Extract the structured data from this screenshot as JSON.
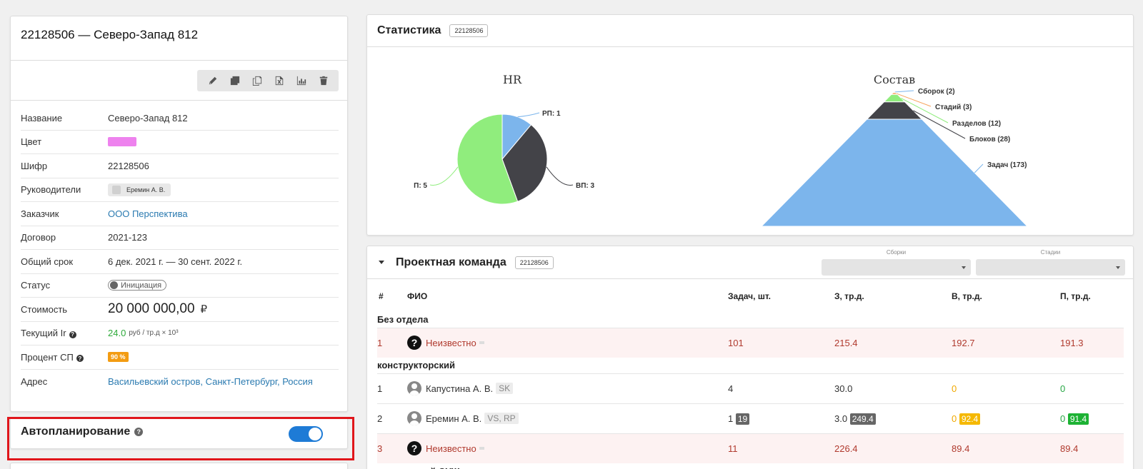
{
  "project": {
    "title": "22128506 — Северо-Запад 812",
    "toolbar_icons": [
      "pencil-icon",
      "copy-icon",
      "duplicate-icon",
      "excel-icon",
      "chart-icon",
      "trash-icon"
    ]
  },
  "props": {
    "name_label": "Название",
    "name_value": "Северо-Запад 812",
    "color_label": "Цвет",
    "color_value": "#ee82ee",
    "code_label": "Шифр",
    "code_value": "22128506",
    "managers_label": "Руководители",
    "managers_value": "Еремин А. В.",
    "customer_label": "Заказчик",
    "customer_value": "ООО Перспектива",
    "contract_label": "Договор",
    "contract_value": "2021-123",
    "term_label": "Общий срок",
    "term_value": "6 дек. 2021 г. — 30 сент. 2022 г.",
    "status_label": "Статус",
    "status_value": "Инициация",
    "cost_label": "Стоимость",
    "cost_value": "20 000 000,00",
    "cost_currency": "₽",
    "ir_label": "Текущий Ir",
    "ir_value": "24.0",
    "ir_unit": "руб / тр.д × 10³",
    "sp_label": "Процент СП",
    "sp_value": "90 %",
    "address_label": "Адрес",
    "address_value": "Васильевский остров, Санкт-Петербург, Россия"
  },
  "auto": {
    "title": "Автопланирование",
    "enabled": true
  },
  "stats": {
    "title": "Статистика",
    "tag": "22128506",
    "hr_title": "HR",
    "composition_title": "Состав"
  },
  "chart_data": [
    {
      "type": "pie",
      "title": "HR",
      "categories": [
        "РП",
        "ВП",
        "П"
      ],
      "values": [
        1,
        3,
        5
      ],
      "labels": [
        "РП: 1",
        "ВП: 3",
        "П: 5"
      ],
      "colors": [
        "#7cb5ec",
        "#434348",
        "#90ed7d"
      ]
    },
    {
      "type": "pyramid",
      "title": "Состав",
      "categories": [
        "Сборок",
        "Стадий",
        "Разделов",
        "Блоков",
        "Задач"
      ],
      "values": [
        2,
        3,
        12,
        28,
        173
      ],
      "labels": [
        "Сборок (2)",
        "Стадий (3)",
        "Разделов (12)",
        "Блоков (28)",
        "Задач (173)"
      ],
      "colors": [
        "#7cb5ec",
        "#f7a35c",
        "#90ed7d",
        "#434348",
        "#7cb5ec"
      ]
    }
  ],
  "team": {
    "title": "Проектная команда",
    "tag": "22128506",
    "filter1_label": "Сборки",
    "filter2_label": "Стадии",
    "headers": {
      "idx": "#",
      "name": "ФИО",
      "tasks": "Задач, шт.",
      "z": "З, тр.д.",
      "v": "В, тр.д.",
      "p": "П, тр.д."
    },
    "group1": "Без отдела",
    "group2": "конструкторский",
    "group3": "инженерный ОУЖ",
    "r1": {
      "idx": "1",
      "name": "Неизвестно",
      "tasks": "101",
      "z": "215.4",
      "v": "192.7",
      "p": "191.3"
    },
    "r2": {
      "idx": "1",
      "name": "Капустина А. В.",
      "role": "SK",
      "tasks": "4",
      "z": "30.0",
      "v": "0",
      "p": "0"
    },
    "r3": {
      "idx": "2",
      "name": "Еремин А. В.",
      "role": "VS, RP",
      "tasks": "1",
      "tasks_badge": "19",
      "z": "3.0",
      "z_badge": "249.4",
      "v": "0",
      "v_badge": "92.4",
      "p": "0",
      "p_badge": "91.4"
    },
    "r4": {
      "idx": "3",
      "name": "Неизвестно",
      "tasks": "11",
      "z": "226.4",
      "v": "89.4",
      "p": "89.4"
    }
  }
}
